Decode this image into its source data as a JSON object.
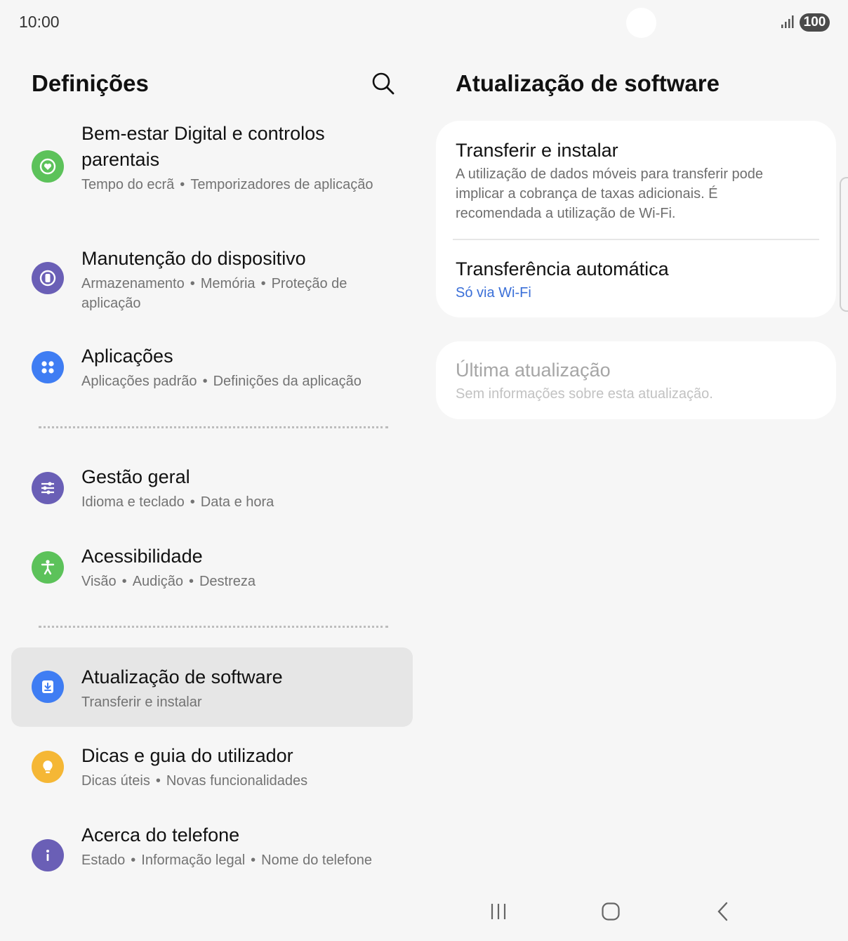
{
  "status_bar": {
    "time": "10:00",
    "battery": "100",
    "icons": [
      "signal-icon",
      "battery-icon"
    ]
  },
  "left": {
    "title": "Definições",
    "search_icon": "search-icon",
    "items": [
      {
        "title": "Bem-estar Digital e controlos parentais",
        "subs": [
          "Tempo do ecrã",
          "Temporizadores de aplicação"
        ],
        "icon": "digital-wellbeing-icon",
        "color": "#5cc25a"
      },
      {
        "title": "Manutenção do dispositivo",
        "subs": [
          "Armazenamento",
          "Memória",
          "Proteção de aplicação"
        ],
        "icon": "device-care-icon",
        "color": "#6a5fb6"
      },
      {
        "title": "Aplicações",
        "subs": [
          "Aplicações padrão",
          "Definições da aplicação"
        ],
        "icon": "apps-icon",
        "color": "#3f7df3"
      },
      {
        "title": "Gestão geral",
        "subs": [
          "Idioma e teclado",
          "Data e hora"
        ],
        "icon": "general-management-icon",
        "color": "#6a5fb6"
      },
      {
        "title": "Acessibilidade",
        "subs": [
          "Visão",
          "Audição",
          "Destreza"
        ],
        "icon": "accessibility-icon",
        "color": "#5cc25a"
      },
      {
        "title": "Atualização de software",
        "subs": [
          "Transferir e instalar"
        ],
        "icon": "software-update-icon",
        "color": "#3f7df3"
      },
      {
        "title": "Dicas e guia do utilizador",
        "subs": [
          "Dicas úteis",
          "Novas funcionalidades"
        ],
        "icon": "tips-icon",
        "color": "#f5b735"
      },
      {
        "title": "Acerca do telefone",
        "subs": [
          "Estado",
          "Informação legal",
          "Nome do telefone"
        ],
        "icon": "about-phone-icon",
        "color": "#6a5fb6"
      }
    ]
  },
  "right": {
    "title": "Atualização de software",
    "download": {
      "title": "Transferir e instalar",
      "desc": "A utilização de dados móveis para transferir pode implicar a cobrança de taxas adicionais. É recomendada a utilização de Wi-Fi."
    },
    "auto": {
      "title": "Transferência automática",
      "value": "Só via Wi-Fi"
    },
    "last": {
      "title": "Última atualização",
      "desc": "Sem informações sobre esta atualização."
    }
  },
  "nav": {
    "icons": [
      "recents-icon",
      "home-icon",
      "back-icon"
    ]
  }
}
